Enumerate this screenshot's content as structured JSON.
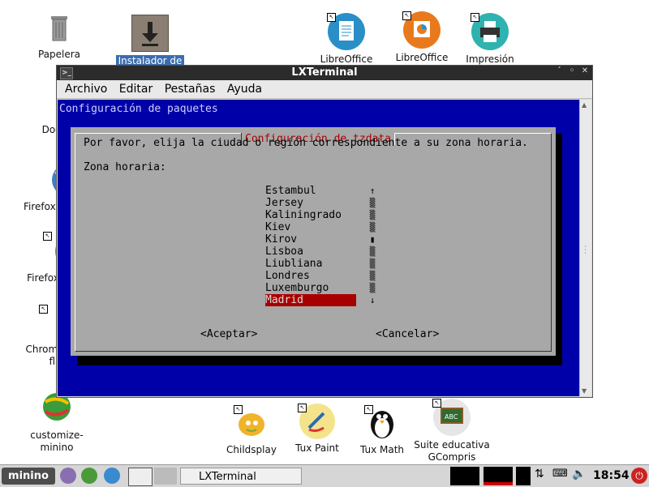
{
  "desktop": {
    "icons": [
      {
        "label": "Papelera"
      },
      {
        "label": "Instalador de"
      },
      {
        "label": "LibreOffice Writer"
      },
      {
        "label": "LibreOffice"
      },
      {
        "label": "Impresión"
      },
      {
        "label": "Docu"
      },
      {
        "label": "Firefox-"
      },
      {
        "label": "Firefox"
      },
      {
        "label": "Chromi"
      },
      {
        "label": "fla"
      },
      {
        "label": "customize-"
      },
      {
        "label": "minino"
      },
      {
        "label": "Childsplay"
      },
      {
        "label": "Tux Paint"
      },
      {
        "label": "Tux Math"
      },
      {
        "label": "Suite educativa"
      },
      {
        "label": "GCompris"
      }
    ]
  },
  "window": {
    "title": "LXTerminal",
    "menu": [
      "Archivo",
      "Editar",
      "Pestañas",
      "Ayuda"
    ]
  },
  "terminal": {
    "package_header": "Configuración de paquetes",
    "dialog_title": "Configuración de tzdata",
    "prompt": "Por favor, elija la ciudad o región correspondiente a su zona horaria.",
    "zone_label": "Zona horaria:",
    "cities": [
      "Estambul",
      "Jersey",
      "Kaliningrado",
      "Kiev",
      "Kirov",
      "Lisboa",
      "Liubliana",
      "Londres",
      "Luxemburgo",
      "Madrid"
    ],
    "selected_city": "Madrid",
    "accept": "<Aceptar>",
    "cancel": "<Cancelar>"
  },
  "taskbar": {
    "start_label": "minino",
    "task_label": "LXTerminal",
    "clock": "18:54"
  }
}
